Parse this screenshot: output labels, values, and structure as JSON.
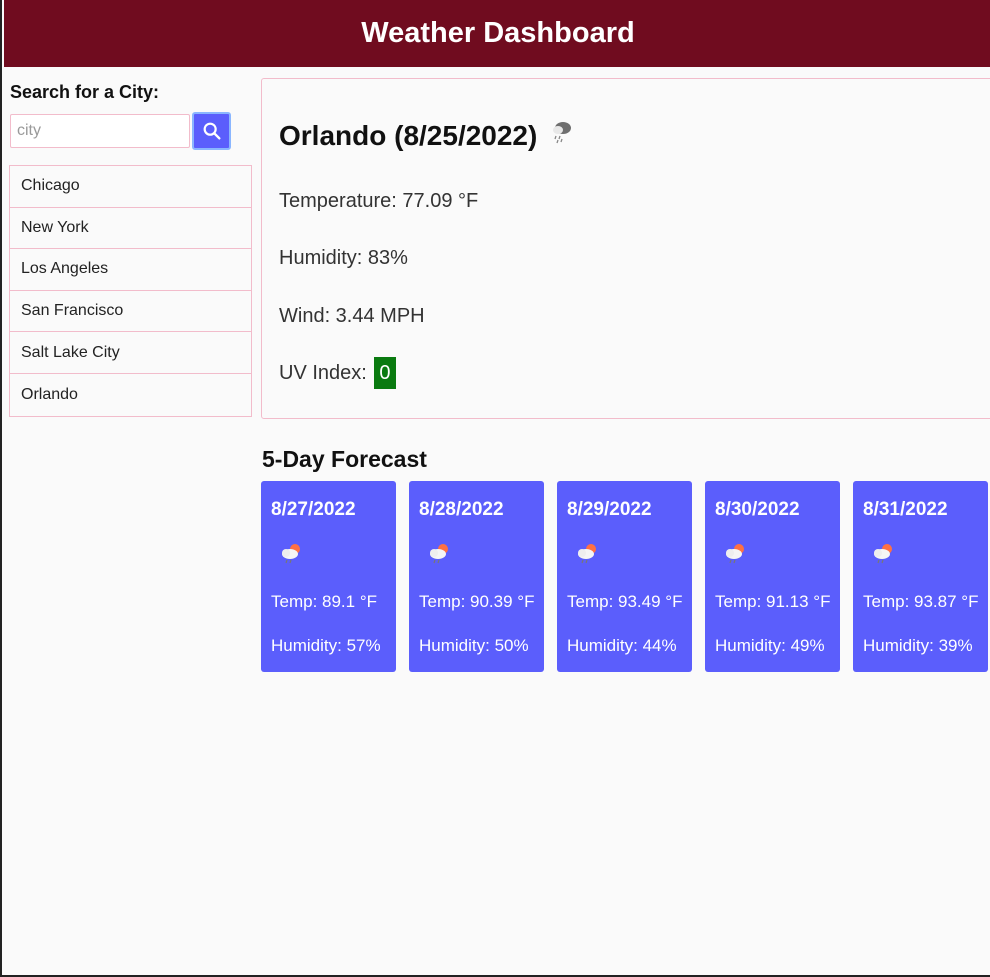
{
  "header": {
    "title": "Weather Dashboard"
  },
  "search": {
    "title": "Search for a City:",
    "placeholder": "city",
    "value": "",
    "button_icon": "search-icon"
  },
  "history": [
    "Chicago",
    "New York",
    "Los Angeles",
    "San Francisco",
    "Salt Lake City",
    "Orlando"
  ],
  "current": {
    "title": "Orlando (8/25/2022)",
    "icon": "rain-cloud-icon",
    "temperature": "Temperature: 77.09 °F",
    "humidity": "Humidity: 83%",
    "wind": "Wind: 3.44 MPH",
    "uv_label": "UV Index:",
    "uv_value": "0",
    "uv_color": "#0a7a10"
  },
  "forecast": {
    "title": "5-Day Forecast",
    "card_color": "#5b5efc",
    "days": [
      {
        "date": "8/27/2022",
        "icon": "sun-rain-cloud-icon",
        "temp": "Temp: 89.1 °F",
        "humidity": "Humidity: 57%"
      },
      {
        "date": "8/28/2022",
        "icon": "sun-rain-cloud-icon",
        "temp": "Temp: 90.39 °F",
        "humidity": "Humidity: 50%"
      },
      {
        "date": "8/29/2022",
        "icon": "sun-rain-cloud-icon",
        "temp": "Temp: 93.49 °F",
        "humidity": "Humidity: 44%"
      },
      {
        "date": "8/30/2022",
        "icon": "sun-rain-cloud-icon",
        "temp": "Temp: 91.13 °F",
        "humidity": "Humidity: 49%"
      },
      {
        "date": "8/31/2022",
        "icon": "sun-rain-cloud-icon",
        "temp": "Temp: 93.87 °F",
        "humidity": "Humidity: 39%"
      }
    ]
  },
  "colors": {
    "header": "#700c1f",
    "accent": "#5b5efc",
    "border": "#f2bccb"
  }
}
